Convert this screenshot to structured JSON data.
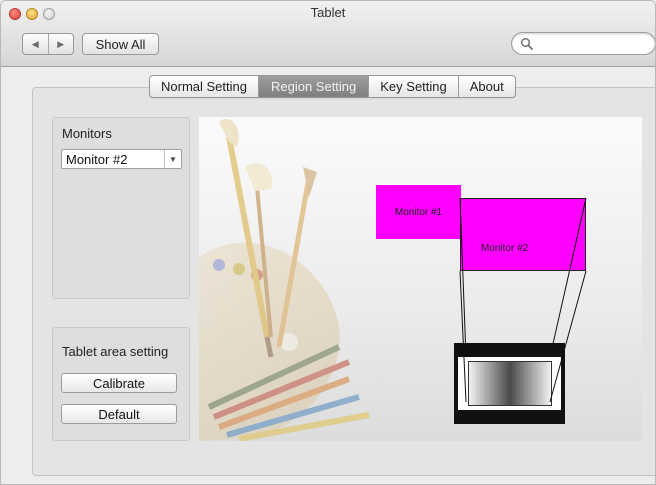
{
  "window": {
    "title": "Tablet"
  },
  "toolbar": {
    "back": "◀",
    "forward": "▶",
    "show_all": "Show All",
    "search_placeholder": ""
  },
  "tabs": [
    {
      "label": "Normal Setting",
      "active": false
    },
    {
      "label": "Region Setting",
      "active": true
    },
    {
      "label": "Key Setting",
      "active": false
    },
    {
      "label": "About",
      "active": false
    }
  ],
  "monitors": {
    "label": "Monitors",
    "selected": "Monitor #2"
  },
  "tablet_area": {
    "label": "Tablet area setting",
    "calibrate": "Calibrate",
    "default": "Default"
  },
  "region": {
    "monitor1_label": "Monitor #1",
    "monitor2_label": "Monitor #2",
    "monitor_color": "#ff00ff"
  }
}
